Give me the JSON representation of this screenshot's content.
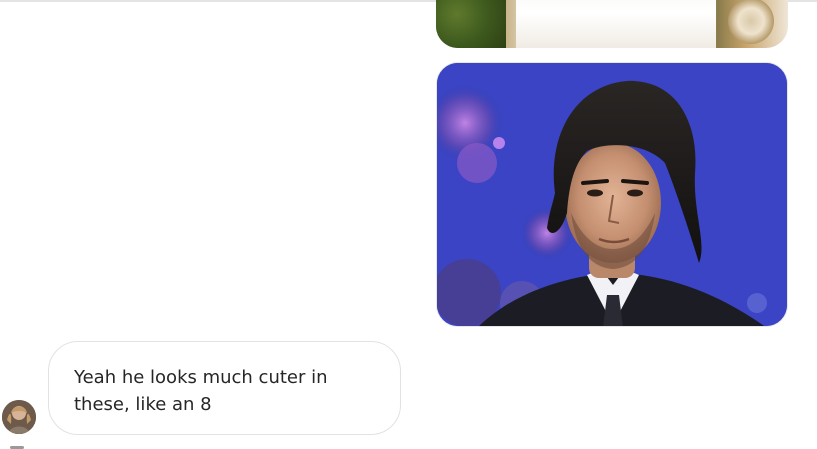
{
  "conversation": {
    "messages": [
      {
        "direction": "outgoing",
        "type": "image",
        "cropped": true,
        "image_label": "photo-partial"
      },
      {
        "direction": "outgoing",
        "type": "image",
        "image_label": "photo-man-suit"
      },
      {
        "direction": "incoming",
        "type": "text",
        "text": "Yeah he looks much cuter in these, like an 8"
      }
    ]
  },
  "colors": {
    "bubble_border": "#e2e2e2",
    "text": "#262626",
    "background": "#ffffff",
    "photo_backdrop": "#3a47c8"
  },
  "icons": {
    "avatar": "avatar"
  }
}
